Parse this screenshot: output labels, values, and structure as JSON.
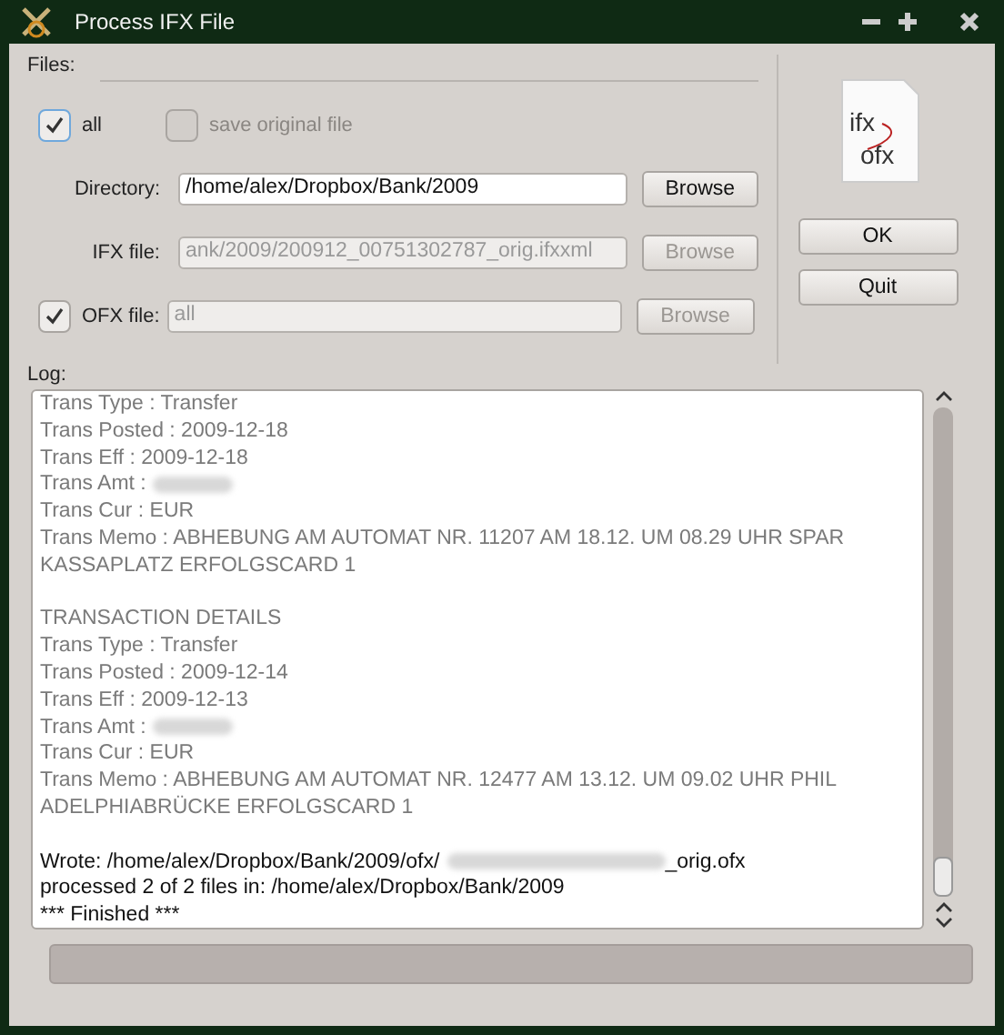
{
  "window": {
    "title": "Process IFX File"
  },
  "files": {
    "label": "Files:",
    "all": {
      "label": "all",
      "checked": true
    },
    "save_original": {
      "label": "save original file",
      "checked": false,
      "disabled": true
    },
    "directory": {
      "label": "Directory:",
      "value": "/home/alex/Dropbox/Bank/2009",
      "browse": "Browse",
      "disabled": false
    },
    "ifx_file": {
      "label": "IFX file:",
      "value": "ank/2009/200912_00751302787_orig.ifxxml",
      "browse": "Browse",
      "disabled": true
    },
    "ofx_file": {
      "label": "OFX file:",
      "checked": true,
      "value": "all",
      "browse": "Browse",
      "disabled": true
    }
  },
  "logo": {
    "top": "ifx",
    "bottom": "ofx"
  },
  "buttons": [
    {
      "label": "OK"
    },
    {
      "label": "Quit"
    }
  ],
  "log": {
    "label": "Log:",
    "blocks": [
      [
        {
          "text": "Trans Type : Transfer",
          "dim": true
        },
        {
          "text": "Trans Posted : 2009-12-18",
          "dim": true
        },
        {
          "text": "Trans Eff : 2009-12-18",
          "dim": true
        },
        {
          "text": "Trans Amt :",
          "dim": true,
          "blurred": true
        },
        {
          "text": "Trans Cur : EUR",
          "dim": true
        },
        {
          "text": "Trans Memo : ABHEBUNG AM AUTOMAT NR. 11207 AM 18.12. UM 08.29 UHR SPAR",
          "dim": true
        },
        {
          "text": "KASSAPLATZ ERFOLGSCARD 1",
          "dim": true
        }
      ],
      [
        {
          "text": "TRANSACTION DETAILS",
          "dim": true
        },
        {
          "text": "Trans Type : Transfer",
          "dim": true
        },
        {
          "text": "Trans Posted : 2009-12-14",
          "dim": true
        },
        {
          "text": "Trans Eff : 2009-12-13",
          "dim": true
        },
        {
          "text": "Trans Amt :",
          "dim": true,
          "blurred": true
        },
        {
          "text": "Trans Cur : EUR",
          "dim": true
        },
        {
          "text": "Trans Memo : ABHEBUNG AM AUTOMAT NR. 12477 AM 13.12. UM 09.02 UHR PHIL",
          "dim": true
        },
        {
          "text": "ADELPHIABRÜCKE ERFOLGSCARD 1",
          "dim": true
        }
      ],
      [
        {
          "text": "Wrote: /home/alex/Dropbox/Bank/2009/ofx/",
          "dim": false,
          "blurred": true,
          "tail": "_orig.ofx"
        },
        {
          "text": "processed 2 of 2 files in: /home/alex/Dropbox/Bank/2009",
          "dim": false
        },
        {
          "text": "*** Finished ***",
          "dim": false
        }
      ]
    ]
  },
  "progress": {
    "level": 0
  }
}
